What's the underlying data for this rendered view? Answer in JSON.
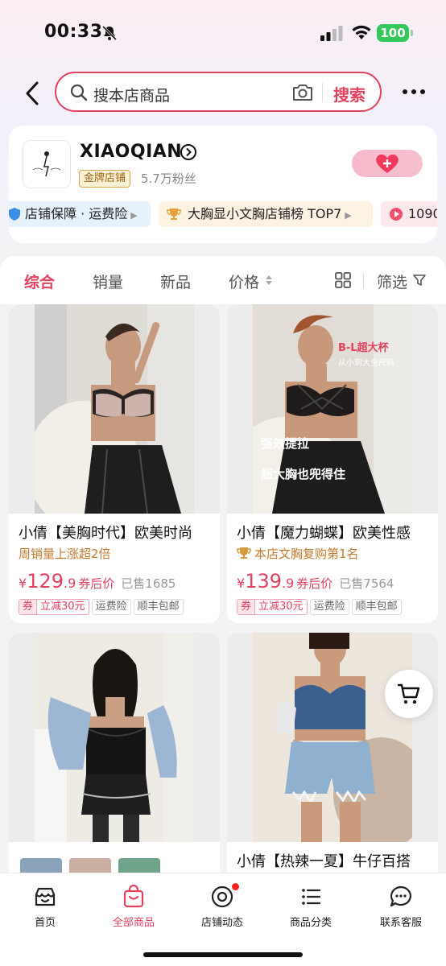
{
  "status_bar": {
    "time": "00:33",
    "battery": "100"
  },
  "search": {
    "placeholder": "搜本店商品",
    "button": "搜索"
  },
  "store": {
    "name": "XIAOQIAN",
    "badge": "金牌店铺",
    "fans": "5.7万粉丝",
    "chips": [
      "店铺保障 · 运费险",
      "大胸显小文胸店铺榜 TOP7",
      "1090"
    ]
  },
  "sort_tabs": {
    "all": "综合",
    "sales": "销量",
    "new": "新品",
    "price": "价格",
    "filter": "筛选"
  },
  "products": [
    {
      "title": "小倩【美胸时代】欧美时尚",
      "subtitle": "周销量上涨超2倍",
      "yen": "¥",
      "price_int": "129",
      "price_dec": ".9",
      "price_note": "券后价",
      "sold": "已售1685",
      "coupon_label": "券",
      "coupon_value": "立减30元",
      "tags": [
        "运费险",
        "顺丰包邮"
      ]
    },
    {
      "title": "小倩【魔力蝴蝶】欧美性感",
      "subtitle": "本店文胸复购第1名",
      "yen": "¥",
      "price_int": "139",
      "price_dec": ".9",
      "price_note": "券后价",
      "sold": "已售7564",
      "coupon_label": "券",
      "coupon_value": "立减30元",
      "tags": [
        "运费险",
        "顺丰包邮"
      ],
      "image_text": [
        "B-L超大杯",
        "从小到大全尺码",
        "强效提拉",
        "超大胸也兜得住"
      ]
    },
    {
      "title": ""
    },
    {
      "title": "小倩【热辣一夏】牛仔百搭"
    }
  ],
  "bottom_nav": [
    "首页",
    "全部商品",
    "店铺动态",
    "商品分类",
    "联系客服"
  ],
  "colors": {
    "accent": "#e4415f",
    "gold": "#c47a2c",
    "battery": "#34c759"
  }
}
